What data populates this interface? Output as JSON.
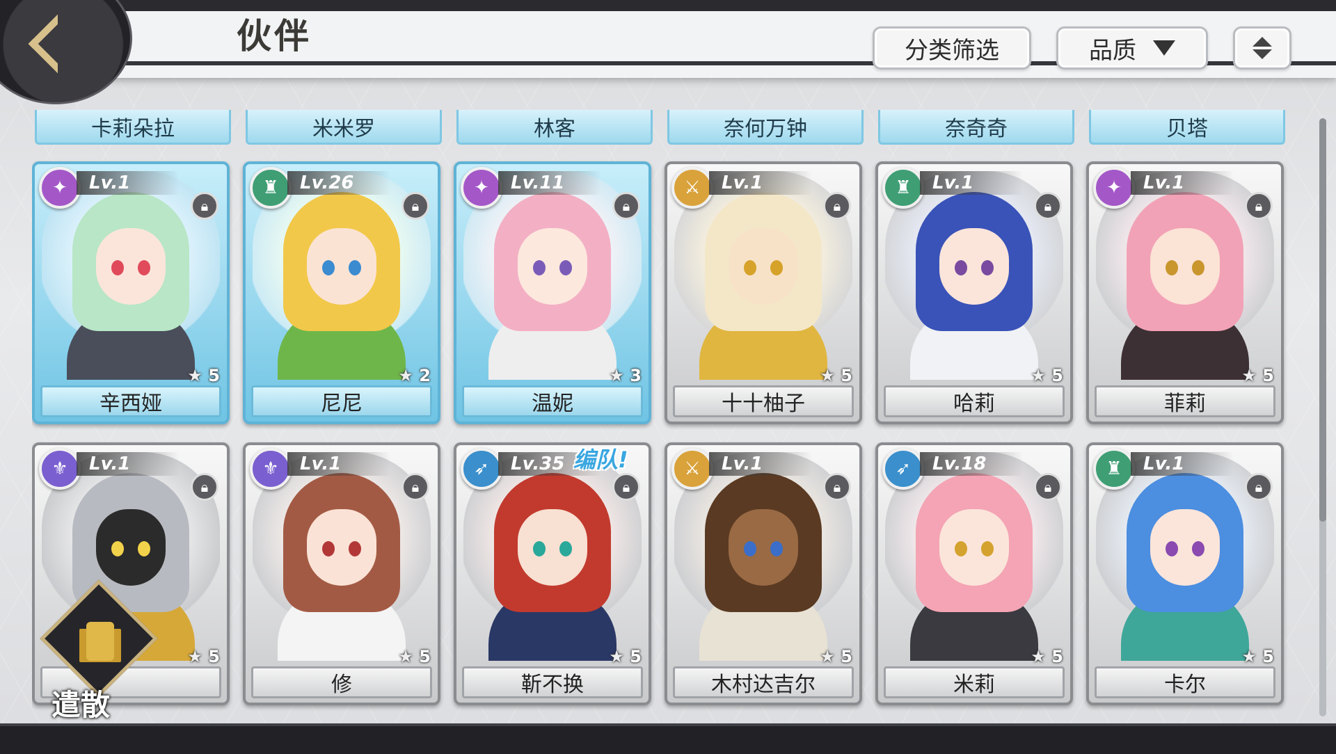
{
  "header": {
    "title": "伙伴",
    "filter_label": "分类筛选",
    "quality_label": "品质"
  },
  "top_strip_names": [
    "卡莉朵拉",
    "米米罗",
    "林客",
    "奈何万钟",
    "奈奇奇",
    "贝塔"
  ],
  "cards": [
    {
      "name": "辛西娅",
      "level": "Lv.1",
      "stars": "5",
      "role": "mage",
      "tier": "blue"
    },
    {
      "name": "尼尼",
      "level": "Lv.26",
      "stars": "2",
      "role": "support",
      "tier": "blue"
    },
    {
      "name": "温妮",
      "level": "Lv.11",
      "stars": "3",
      "role": "mage",
      "tier": "blue"
    },
    {
      "name": "十十柚子",
      "level": "Lv.1",
      "stars": "5",
      "role": "warrior",
      "tier": "silver"
    },
    {
      "name": "哈莉",
      "level": "Lv.1",
      "stars": "5",
      "role": "support",
      "tier": "silver"
    },
    {
      "name": "菲莉",
      "level": "Lv.1",
      "stars": "5",
      "role": "mage",
      "tier": "silver"
    },
    {
      "name": "",
      "level": "Lv.1",
      "stars": "5",
      "role": "tank",
      "tier": "silver"
    },
    {
      "name": "修",
      "level": "Lv.1",
      "stars": "5",
      "role": "tank",
      "tier": "silver"
    },
    {
      "name": "靳不换",
      "level": "Lv.35",
      "stars": "5",
      "role": "archer",
      "tier": "silver",
      "badge": "编队!"
    },
    {
      "name": "木村达吉尔",
      "level": "Lv.1",
      "stars": "5",
      "role": "warrior",
      "tier": "silver"
    },
    {
      "name": "米莉",
      "level": "Lv.18",
      "stars": "5",
      "role": "archer",
      "tier": "silver"
    },
    {
      "name": "卡尔",
      "level": "Lv.1",
      "stars": "5",
      "role": "support",
      "tier": "silver"
    }
  ],
  "dismiss_label": "遣散",
  "colors": {
    "mage": "#a458c8",
    "support": "#3f9e74",
    "warrior": "#d9a23a",
    "tank": "#7a5fd0",
    "archer": "#3a8fcc"
  }
}
